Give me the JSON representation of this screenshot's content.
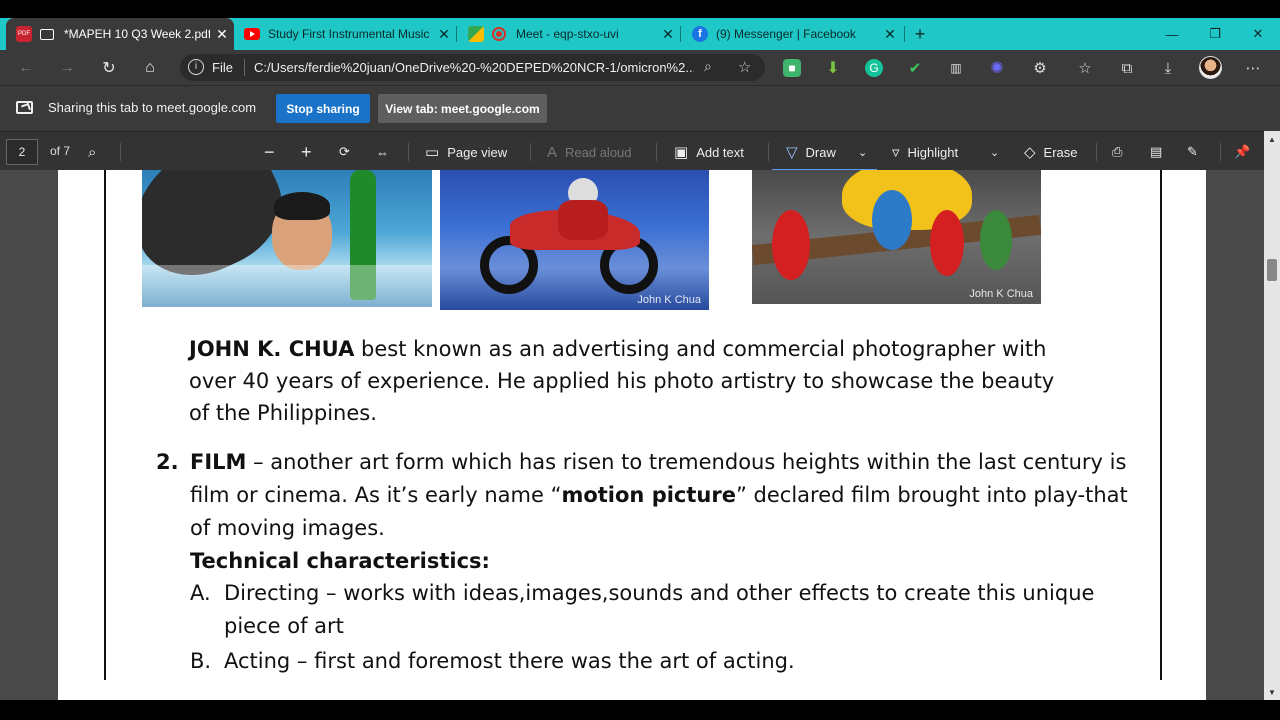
{
  "browser": {
    "tabs": [
      {
        "title": "*MAPEH 10 Q3 Week 2.pdf",
        "active": true,
        "icon": "pdf-icon"
      },
      {
        "title": "Study First Instrumental Music T",
        "active": false,
        "icon": "youtube-icon"
      },
      {
        "title": "Meet - eqp-stxo-uvi",
        "active": false,
        "icon": "meet-icon"
      },
      {
        "title": "(9) Messenger | Facebook",
        "active": false,
        "icon": "facebook-icon"
      }
    ],
    "close_glyph": "✕",
    "new_tab_glyph": "+",
    "window_controls": {
      "minimize": "—",
      "restore": "❐",
      "close": "✕"
    },
    "address": {
      "scheme": "File",
      "url": "C:/Users/ferdie%20juan/OneDrive%20-%20DEPED%20NCR-1/omicron%2..."
    }
  },
  "share_bar": {
    "message": "Sharing this tab to meet.google.com",
    "stop_label": "Stop sharing",
    "view_label": "View tab: meet.google.com"
  },
  "pdf_toolbar": {
    "page_number": "2",
    "page_count": "of 7",
    "page_view": "Page view",
    "read_aloud": "Read aloud",
    "add_text": "Add text",
    "draw": "Draw",
    "highlight": "Highlight",
    "erase": "Erase"
  },
  "document": {
    "photo_credit": "John K Chua",
    "chua_name": "JOHN K. CHUA",
    "chua_line1_rest": " best known as an advertising and commercial photographer with",
    "chua_line2": "over 40 years of experience. He applied his photo artistry to showcase the beauty",
    "chua_line3": "of the Philippines.",
    "item_number": "2.",
    "film_term": "FILM",
    "film_line1_rest": " – another art form which has risen to tremendous heights within the last century is",
    "film_line2_pre": "film or cinema. As it’s early name “",
    "film_line2_bold": "motion picture",
    "film_line2_post": "” declared film brought into play-that",
    "film_line3": "of moving images.",
    "tech_heading": "Technical characteristics:",
    "a_letter": "A.",
    "a_line1": "Directing – works with ideas,images,sounds and other effects to create this unique",
    "a_line2": "piece of art",
    "b_letter": "B.",
    "b_line1": "Acting – first and foremost there was the art of acting."
  },
  "colors": {
    "tab_bar": "#1fc7c6",
    "chrome": "#3a3a3a",
    "stop_sharing": "#1a73c8",
    "draw_underline": "#5b9cf6"
  }
}
